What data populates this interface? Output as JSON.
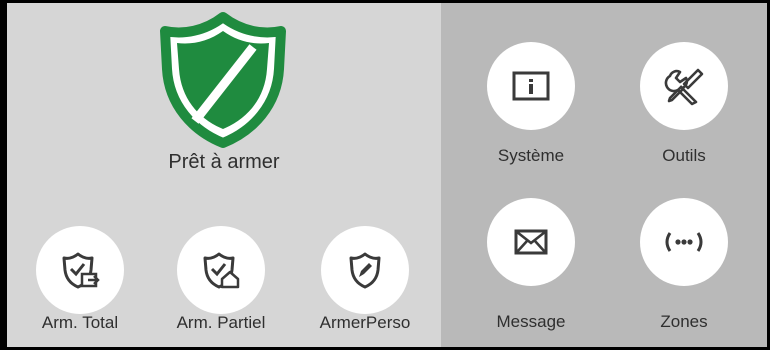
{
  "status": {
    "label": "Prêt à armer",
    "shield_color": "#1f8b3f"
  },
  "arm_buttons": [
    {
      "label": "Arm. Total",
      "icon": "shield-arm-away-icon"
    },
    {
      "label": "Arm. Partiel",
      "icon": "shield-arm-stay-icon"
    },
    {
      "label": "ArmerPerso",
      "icon": "shield-custom-arm-icon"
    }
  ],
  "menu_buttons": [
    {
      "label": "Système",
      "icon": "info-icon"
    },
    {
      "label": "Outils",
      "icon": "tools-icon"
    },
    {
      "label": "Message",
      "icon": "envelope-icon"
    },
    {
      "label": "Zones",
      "icon": "wireless-zones-icon"
    }
  ],
  "colors": {
    "left_panel": "#d6d6d6",
    "right_panel": "#b9b9b9",
    "button_bg": "#ffffff",
    "icon": "#3a3a3a"
  }
}
